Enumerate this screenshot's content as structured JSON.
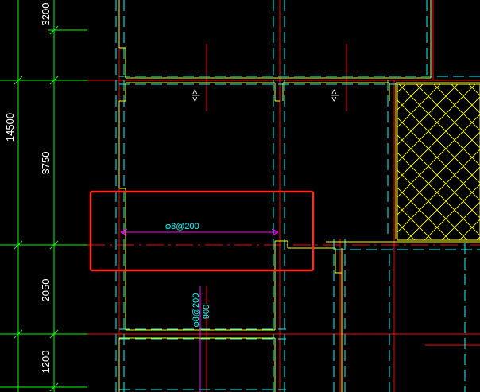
{
  "colors": {
    "background": "#000000",
    "wall": "#ffff00",
    "axis": "#ff0000",
    "hidden": "#00ffff",
    "dimension_line": "#00ff00",
    "dimension_text": "#ffffff",
    "rebar_line": "#ff00ff",
    "highlight": "#ff2a1a"
  },
  "dimensions": {
    "total": "14500",
    "segment_1": "3200",
    "segment_2": "3750",
    "segment_3": "2050",
    "segment_4": "1200"
  },
  "annotations": {
    "rebar_horizontal": "φ8@200",
    "rebar_vertical": "φ8@200",
    "length_vertical": "900",
    "section_mark_1": "<|>",
    "section_mark_2": "<|>"
  },
  "icons": {
    "section_mark": "section-cut-symbol",
    "hatch": "cross-hatch-pattern"
  }
}
